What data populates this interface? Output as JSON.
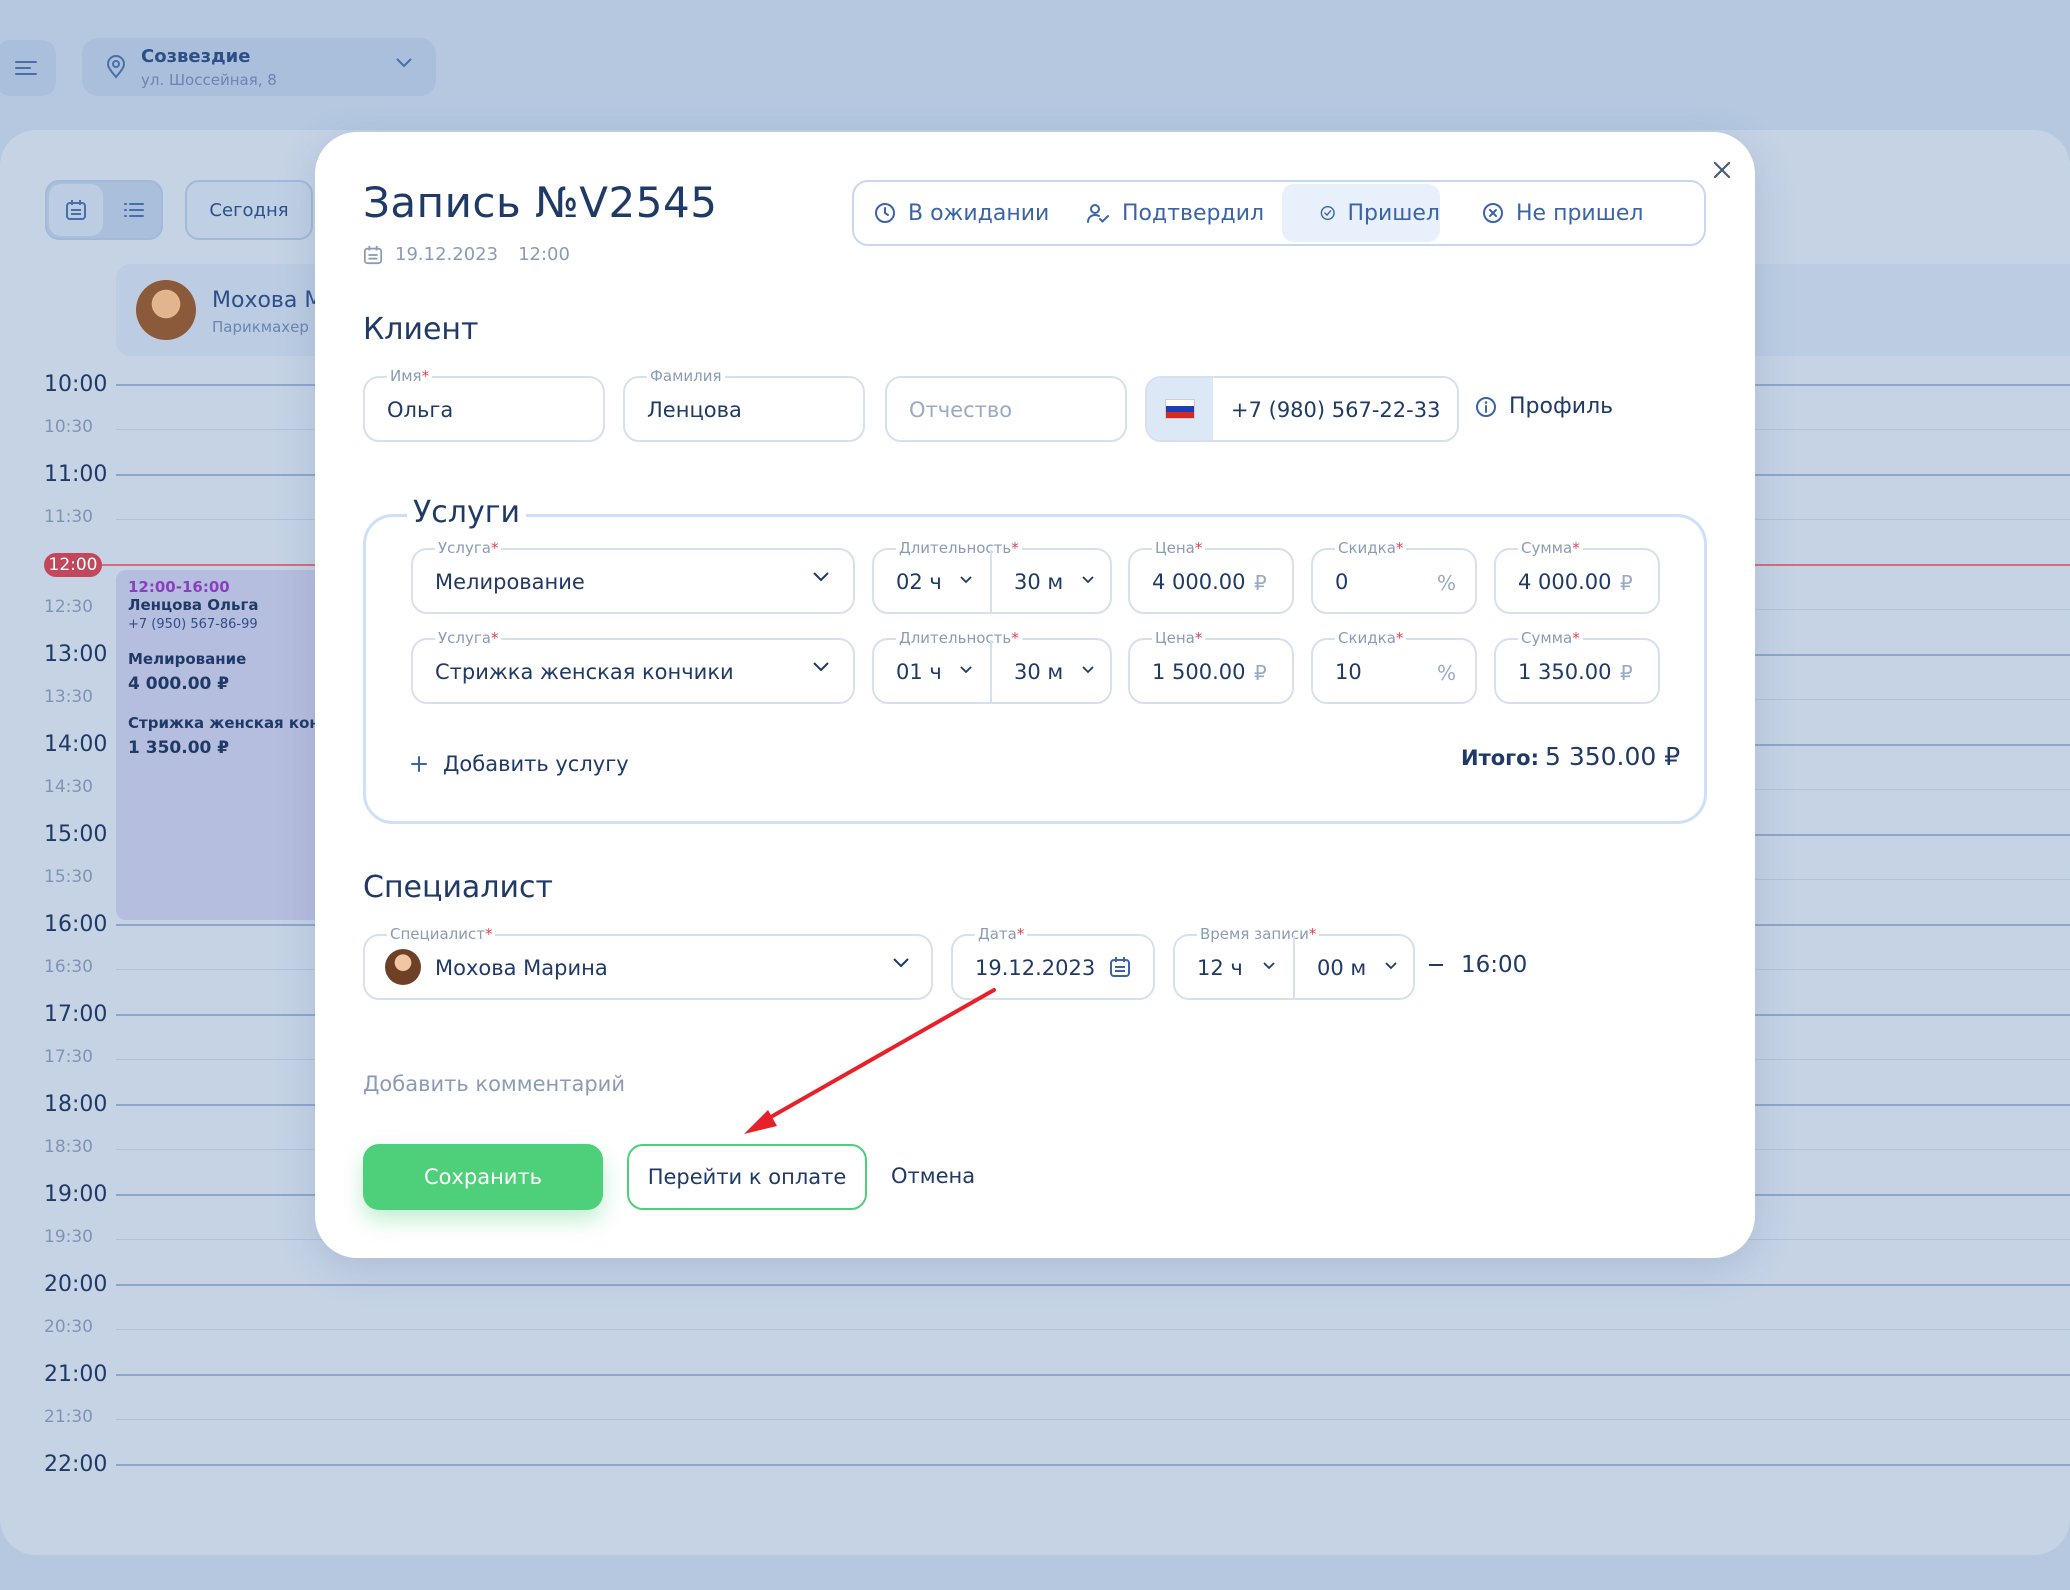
{
  "location": {
    "name": "Созвездие",
    "address": "ул. Шоссейная, 8"
  },
  "toolbar": {
    "today_label": "Сегодня"
  },
  "background_specialist": {
    "name": "Мохова М",
    "role": "Парикмахер"
  },
  "timeline": {
    "labels": [
      "10:00",
      "10:30",
      "11:00",
      "11:30",
      "12:00",
      "12:30",
      "13:00",
      "13:30",
      "14:00",
      "14:30",
      "15:00",
      "15:30",
      "16:00",
      "16:30",
      "17:00",
      "17:30",
      "18:00",
      "18:30",
      "19:00",
      "19:30",
      "20:00",
      "20:30",
      "21:00",
      "21:30",
      "22:00"
    ],
    "now": "12:00"
  },
  "event": {
    "time": "12:00-16:00",
    "client": "Ленцова Ольга",
    "phone": "+7 (950) 567-86-99",
    "service1": "Мелирование",
    "price1": "4 000.00 ₽",
    "service2": "Стрижка женская кончи",
    "price2": "1 350.00 ₽"
  },
  "modal": {
    "title": "Запись №V2545",
    "date": "19.12.2023",
    "time": "12:00",
    "statuses": [
      {
        "label": "В ожидании",
        "icon": "clock-icon",
        "active": false
      },
      {
        "label": "Подтвердил",
        "icon": "user-check-icon",
        "active": false
      },
      {
        "label": "Пришел",
        "icon": "check-circle-icon",
        "active": true
      },
      {
        "label": "Не пришел",
        "icon": "x-circle-icon",
        "active": false
      }
    ],
    "client": {
      "heading": "Клиент",
      "first_name_label": "Имя",
      "first_name": "Ольга",
      "last_name_label": "Фамилия",
      "last_name": "Ленцова",
      "patronymic_placeholder": "Отчество",
      "phone": "+7 (980) 567-22-33",
      "profile_label": "Профиль"
    },
    "services": {
      "heading": "Услуги",
      "labels": {
        "service": "Услуга",
        "duration": "Длительность",
        "price": "Цена",
        "discount": "Скидка",
        "sum": "Сумма"
      },
      "rows": [
        {
          "service": "Мелирование",
          "hours": "02 ч",
          "minutes": "30 м",
          "price": "4 000.00",
          "discount": "0",
          "sum": "4 000.00"
        },
        {
          "service": "Стрижка женская кончики",
          "hours": "01 ч",
          "minutes": "30 м",
          "price": "1 500.00",
          "discount": "10",
          "sum": "1 350.00"
        }
      ],
      "currency": "₽",
      "percent": "%",
      "add_label": "Добавить услугу",
      "total_label": "Итого:",
      "total_value": "5 350.00 ₽"
    },
    "specialist": {
      "heading": "Специалист",
      "specialist_label": "Специалист",
      "specialist_value": "Мохова Марина",
      "date_label": "Дата",
      "date_value": "19.12.2023",
      "time_label": "Время записи",
      "hours": "12 ч",
      "minutes": "00 м",
      "end_time": "16:00"
    },
    "comment_label": "Добавить комментарий",
    "buttons": {
      "save": "Сохранить",
      "pay": "Перейти к оплате",
      "cancel": "Отмена"
    }
  },
  "colors": {
    "accent_green": "#4ecf7a",
    "primary_text": "#1f3a66",
    "status_blue": "#3b64a8",
    "required_red": "#e0425a",
    "annotation_arrow": "#e8202a"
  }
}
